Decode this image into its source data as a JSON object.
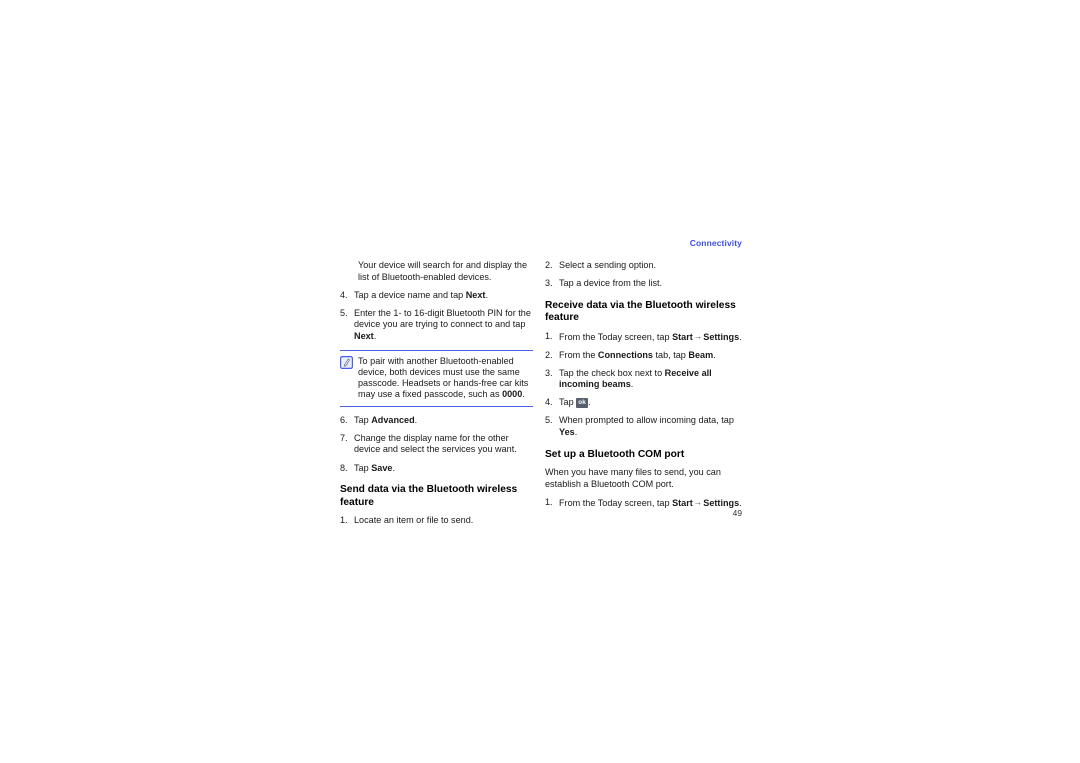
{
  "document": {
    "running_header": "Connectivity",
    "page_number": "49",
    "accent_color": "#3b4ef0",
    "rule_color": "#4a5fe8"
  },
  "left_column": {
    "intro_paragraph": "Your device will search for and display the list of Bluetooth-enabled devices.",
    "steps_continued": [
      {
        "num": "4.",
        "parts": [
          {
            "text": "Tap a device name and tap ",
            "bold": false
          },
          {
            "text": "Next",
            "bold": true
          },
          {
            "text": ".",
            "bold": false
          }
        ]
      },
      {
        "num": "5.",
        "parts": [
          {
            "text": "Enter the 1- to 16-digit Bluetooth PIN for the device you are trying to connect to and tap ",
            "bold": false
          },
          {
            "text": "Next",
            "bold": true
          },
          {
            "text": ".",
            "bold": false
          }
        ]
      }
    ],
    "note": {
      "icon": "note-pencil-icon",
      "parts": [
        {
          "text": "To pair with another Bluetooth-enabled device, both devices must use the same passcode. Headsets or hands-free car kits may use a fixed passcode, such as ",
          "bold": false
        },
        {
          "text": "0000",
          "bold": true
        },
        {
          "text": ".",
          "bold": false
        }
      ]
    },
    "steps_after_note": [
      {
        "num": "6.",
        "parts": [
          {
            "text": "Tap ",
            "bold": false
          },
          {
            "text": "Advanced",
            "bold": true
          },
          {
            "text": ".",
            "bold": false
          }
        ]
      },
      {
        "num": "7.",
        "parts": [
          {
            "text": "Change the display name for the other device and select the services you want.",
            "bold": false
          }
        ]
      },
      {
        "num": "8.",
        "parts": [
          {
            "text": "Tap ",
            "bold": false
          },
          {
            "text": "Save",
            "bold": true
          },
          {
            "text": ".",
            "bold": false
          }
        ]
      }
    ],
    "section": {
      "heading": "Send data via the Bluetooth wireless feature",
      "steps": [
        {
          "num": "1.",
          "parts": [
            {
              "text": "Locate an item or file to send.",
              "bold": false
            }
          ]
        }
      ]
    }
  },
  "right_column": {
    "steps_continued": [
      {
        "num": "2.",
        "parts": [
          {
            "text": "Select a sending option.",
            "bold": false
          }
        ]
      },
      {
        "num": "3.",
        "parts": [
          {
            "text": "Tap a device from the list.",
            "bold": false
          }
        ]
      }
    ],
    "section_receive": {
      "heading": "Receive data via the Bluetooth wireless feature",
      "steps": [
        {
          "num": "1.",
          "parts": [
            {
              "text": "From the Today screen, tap ",
              "bold": false
            },
            {
              "text": "Start",
              "bold": true
            },
            {
              "arrow": true
            },
            {
              "text": "Settings",
              "bold": true
            },
            {
              "text": ".",
              "bold": false
            }
          ]
        },
        {
          "num": "2.",
          "parts": [
            {
              "text": "From the ",
              "bold": false
            },
            {
              "text": "Connections",
              "bold": true
            },
            {
              "text": " tab, tap ",
              "bold": false
            },
            {
              "text": "Beam",
              "bold": true
            },
            {
              "text": ".",
              "bold": false
            }
          ]
        },
        {
          "num": "3.",
          "parts": [
            {
              "text": "Tap the check box next to ",
              "bold": false
            },
            {
              "text": "Receive all incoming beams",
              "bold": true
            },
            {
              "text": ".",
              "bold": false
            }
          ]
        },
        {
          "num": "4.",
          "parts": [
            {
              "text": "Tap ",
              "bold": false
            },
            {
              "okkey": "ok"
            },
            {
              "text": ".",
              "bold": false
            }
          ]
        },
        {
          "num": "5.",
          "parts": [
            {
              "text": "When prompted to allow incoming data, tap ",
              "bold": false
            },
            {
              "text": "Yes",
              "bold": true
            },
            {
              "text": ".",
              "bold": false
            }
          ]
        }
      ]
    },
    "section_com_port": {
      "heading": "Set up a Bluetooth COM port",
      "paragraph": "When you have many files to send, you can establish a Bluetooth COM port.",
      "steps": [
        {
          "num": "1.",
          "parts": [
            {
              "text": "From the Today screen, tap ",
              "bold": false
            },
            {
              "text": "Start",
              "bold": true
            },
            {
              "arrow": true
            },
            {
              "text": "Settings",
              "bold": true
            },
            {
              "text": ".",
              "bold": false
            }
          ]
        }
      ]
    }
  }
}
